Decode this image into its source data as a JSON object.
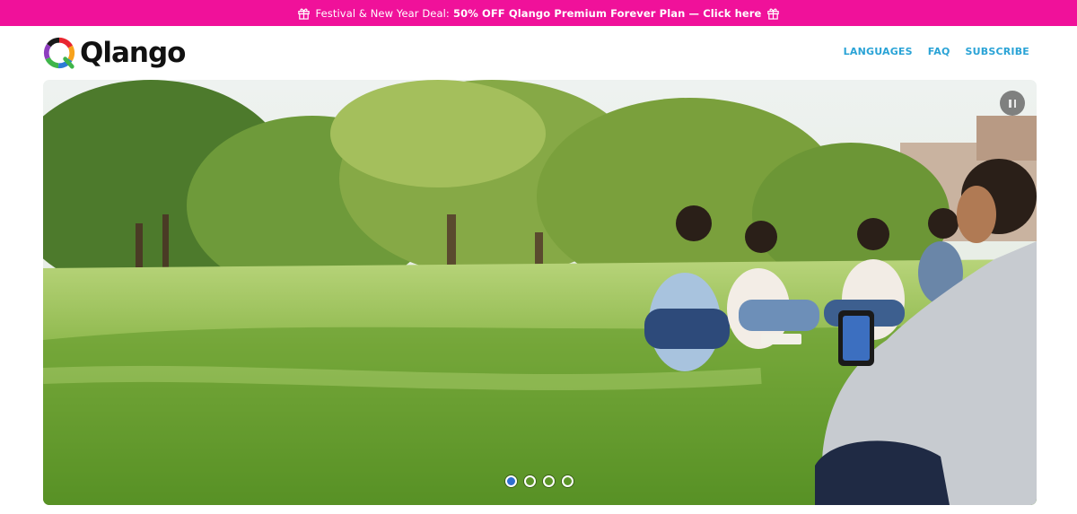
{
  "promo": {
    "text_part1": "Festival & New Year Deal:",
    "text_part2": "50% OFF Qlango Premium Forever Plan — Click here",
    "icon": "gift-icon"
  },
  "header": {
    "logo_text": "Qlango",
    "nav": [
      "LANGUAGES",
      "FAQ",
      "SUBSCRIBE"
    ]
  },
  "hero": {
    "slides": 4,
    "active_slide": 1,
    "pause_icon": "pause-icon",
    "colors": {
      "active_dot": "#2f6fd0",
      "promo_bg": "#f0119a",
      "nav": "#2aa3d6"
    }
  }
}
